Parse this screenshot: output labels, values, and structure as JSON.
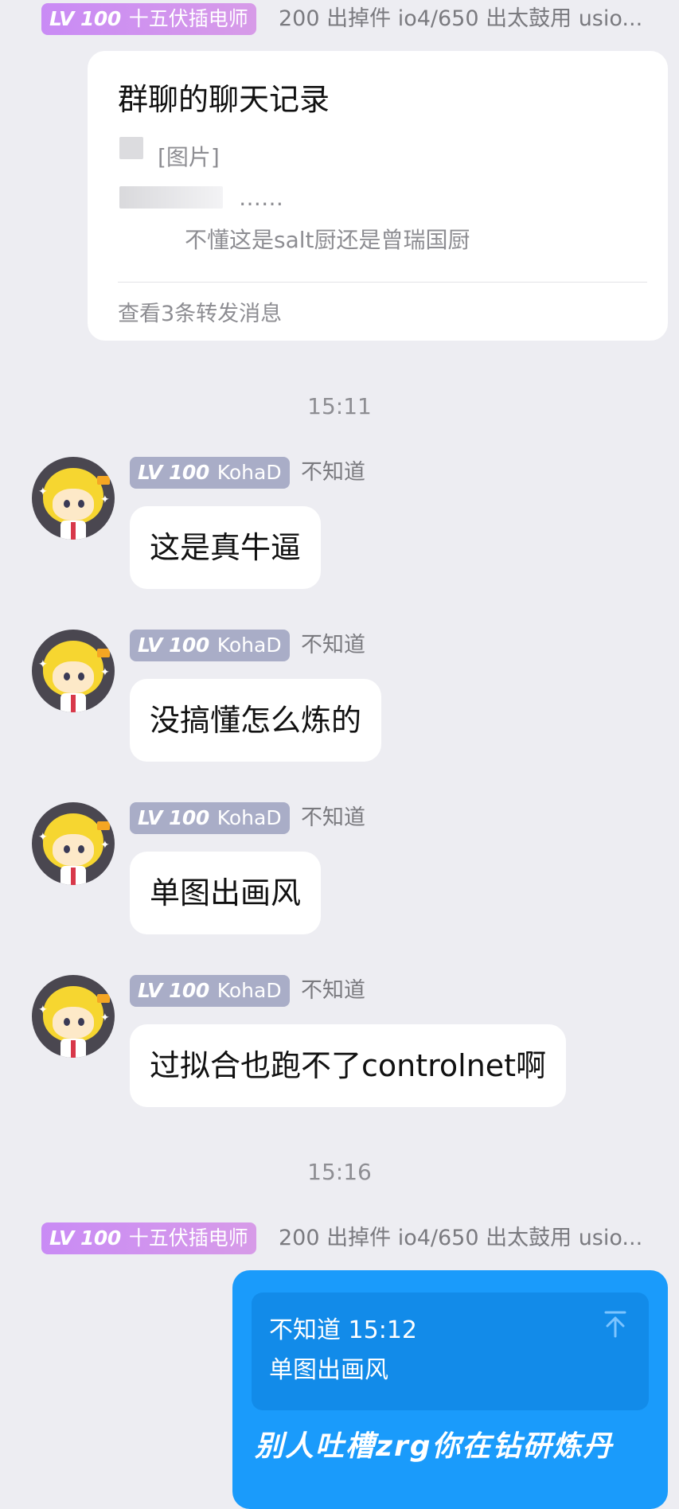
{
  "top_sender": {
    "level": "LV 100",
    "title": "十五伏插电师",
    "name": "200 出掉件 io4/650 出太鼓用 usio..."
  },
  "forward_card": {
    "title": "群聊的聊天记录",
    "line1": "[图片]",
    "line2": "……",
    "line3": "不懂这是salt厨还是曾瑞国厨",
    "footer": "查看3条转发消息"
  },
  "time1": "15:11",
  "messages": [
    {
      "level": "LV 100",
      "title": "KohaD",
      "name": "不知道",
      "text": "这是真牛逼"
    },
    {
      "level": "LV 100",
      "title": "KohaD",
      "name": "不知道",
      "text": "没搞懂怎么炼的"
    },
    {
      "level": "LV 100",
      "title": "KohaD",
      "name": "不知道",
      "text": "单图出画风"
    },
    {
      "level": "LV 100",
      "title": "KohaD",
      "name": "不知道",
      "text": "过拟合也跑不了controlnet啊"
    }
  ],
  "time2": "15:16",
  "bottom_sender": {
    "level": "LV 100",
    "title": "十五伏插电师",
    "name": "200 出掉件 io4/650 出太鼓用 usio..."
  },
  "my_message": {
    "quote_header": "不知道 15:12",
    "quote_text": "单图出画风",
    "text": "别人吐槽zrg你在钻研炼丹"
  },
  "colors": {
    "background": "#ededf2",
    "my_bubble": "#1a9bfb",
    "badge_purple": "#c98bf5",
    "badge_grey": "#a9adc7"
  }
}
